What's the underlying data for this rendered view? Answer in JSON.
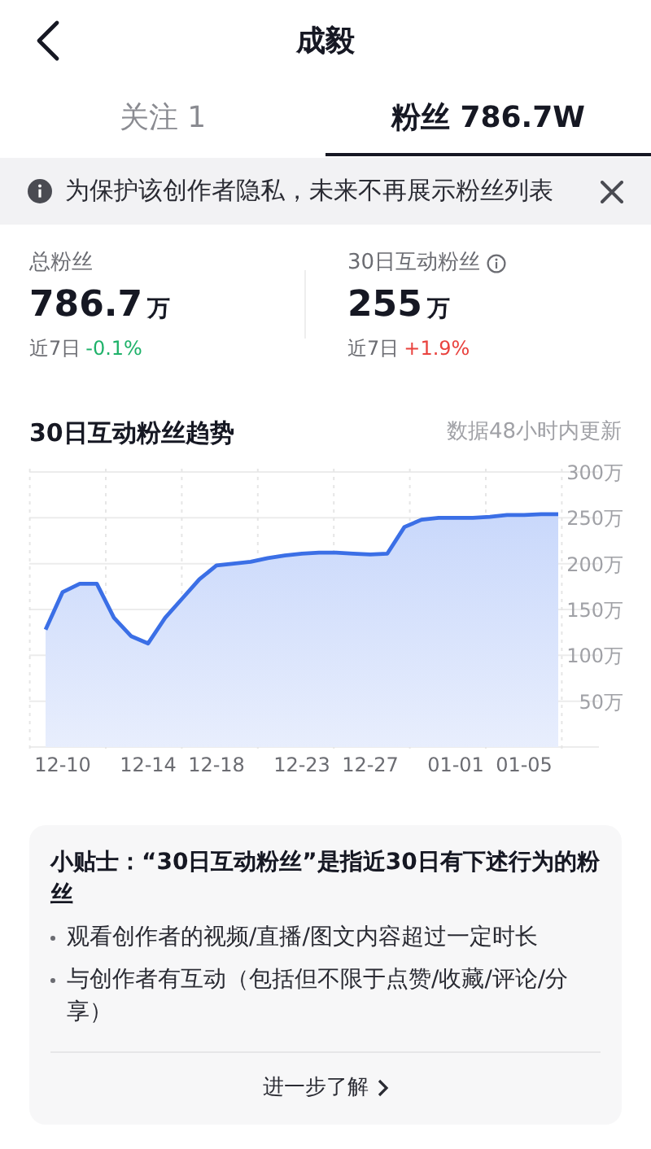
{
  "header": {
    "title": "成毅"
  },
  "tabs": [
    {
      "label": "关注 1",
      "selected": false
    },
    {
      "label": "粉丝 786.7W",
      "selected": true
    }
  ],
  "notice": {
    "text": "为保护该创作者隐私，未来不再展示粉丝列表"
  },
  "stats": [
    {
      "label": "总粉丝",
      "info": false,
      "value": "786.7",
      "unit": "万",
      "period": "近7日",
      "change": "-0.1%",
      "color": "#1fb26a"
    },
    {
      "label": "30日互动粉丝",
      "info": true,
      "value": "255",
      "unit": "万",
      "period": "近7日",
      "change": "+1.9%",
      "color": "#e9433f"
    }
  ],
  "trend": {
    "title": "30日互动粉丝趋势",
    "note": "数据48小时内更新",
    "chart_data": {
      "type": "area",
      "categories": [
        null,
        "12-10",
        null,
        null,
        null,
        null,
        "12-14",
        null,
        null,
        null,
        "12-18",
        null,
        null,
        null,
        null,
        "12-23",
        null,
        null,
        null,
        "12-27",
        null,
        null,
        null,
        null,
        "01-01",
        null,
        null,
        null,
        "01-05",
        null,
        null
      ],
      "series": [
        {
          "color": "#3b6fe6",
          "values": [
            128,
            169,
            178,
            178,
            141,
            121,
            113,
            141,
            162,
            183,
            198,
            200,
            202,
            206,
            209,
            211,
            212,
            212,
            211,
            210,
            211,
            240,
            248,
            250,
            250,
            250,
            251,
            253,
            253,
            254,
            254
          ]
        }
      ],
      "ylim": [
        0,
        300
      ],
      "grid": true,
      "yticks": [
        {
          "value": 50,
          "label": "50万"
        },
        {
          "value": 100,
          "label": "100万"
        },
        {
          "value": 150,
          "label": "150万"
        },
        {
          "value": 200,
          "label": "200万"
        },
        {
          "value": 250,
          "label": "250万"
        },
        {
          "value": 300,
          "label": "300万"
        }
      ]
    }
  },
  "tip": {
    "title": "小贴士：“30日互动粉丝”是指近30日有下述行为的粉丝",
    "bullets": [
      "观看创作者的视频/直播/图文内容超过一定时长",
      "与创作者有互动（包括但不限于点赞/收藏/评论/分享）"
    ],
    "link": "进一步了解"
  }
}
